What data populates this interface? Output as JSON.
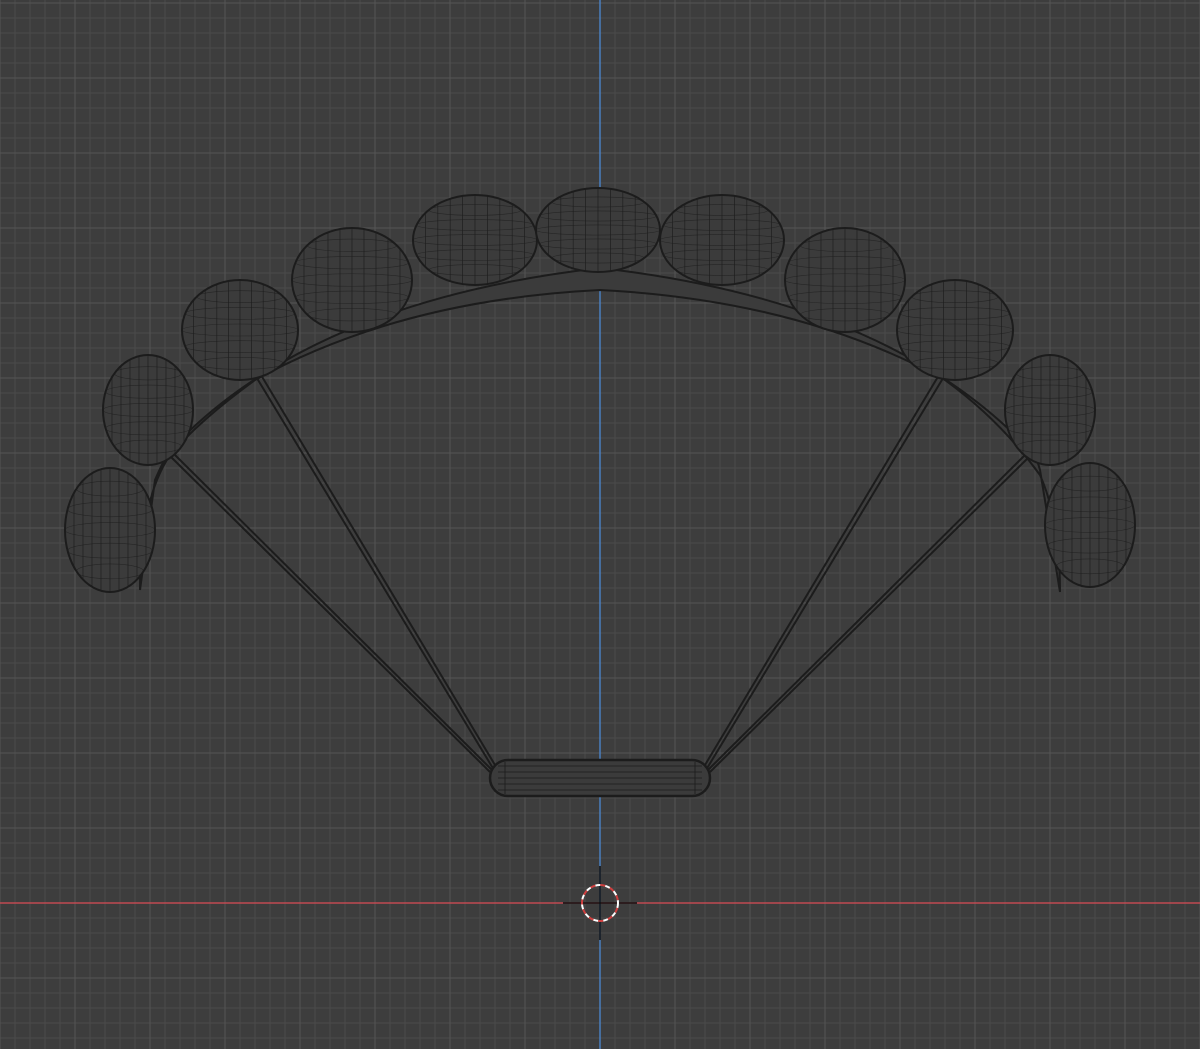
{
  "viewport": {
    "view": "front-orthographic",
    "grid": true,
    "mode": "wireframe"
  },
  "colors": {
    "background": "#3d3d3d",
    "grid_minor": "#4a4a4a",
    "grid_major": "#555555",
    "axis_x": "#c04a52",
    "axis_z": "#4a7fbf",
    "wire": "#1c1c1c",
    "fill": "#3b3b3b",
    "cursor_ring_a": "#ffffff",
    "cursor_ring_b": "#d04040",
    "cursor_cross": "#101010"
  },
  "objects": [
    {
      "name": "parachute-canopy",
      "cells": 11
    },
    {
      "name": "suspension-lines",
      "count": 4
    },
    {
      "name": "harness-bar"
    }
  ],
  "cursor": {
    "icon": "3d-cursor-icon"
  }
}
